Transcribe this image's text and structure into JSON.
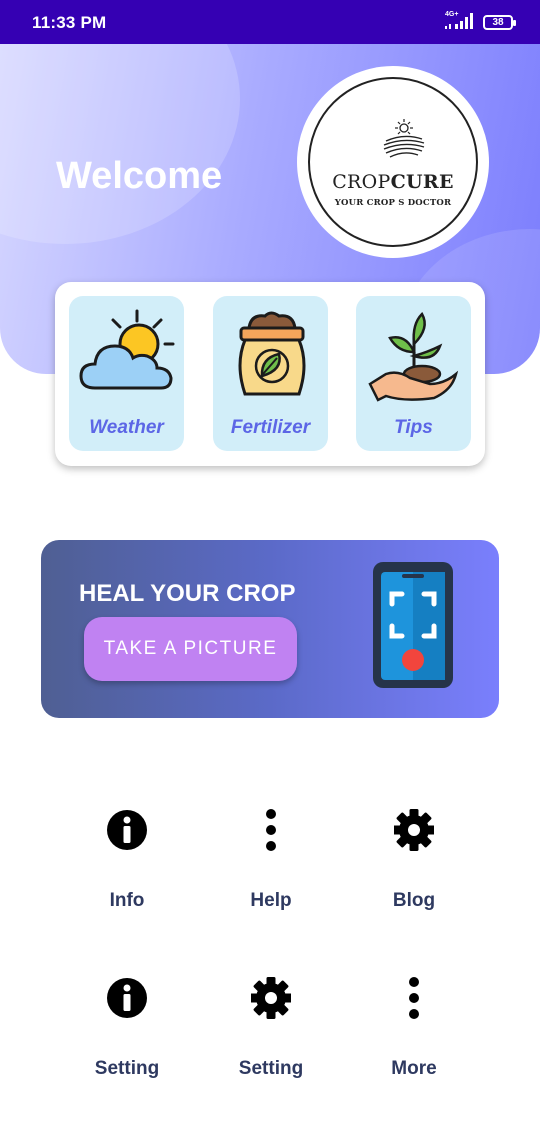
{
  "status_bar": {
    "time": "11:33 PM",
    "network": "4G+",
    "battery": "38"
  },
  "header": {
    "welcome": "Welcome"
  },
  "logo": {
    "brand_light": "CROP",
    "brand_bold": "CURE",
    "tagline": "YOUR CROP S DOCTOR"
  },
  "features": [
    {
      "label": "Weather",
      "icon": "weather-icon"
    },
    {
      "label": "Fertilizer",
      "icon": "fertilizer-icon"
    },
    {
      "label": "Tips",
      "icon": "plant-hand-icon"
    }
  ],
  "heal": {
    "title": "HEAL YOUR CROP",
    "button": "TAKE A PICTURE",
    "icon": "phone-scan-icon"
  },
  "menu": [
    {
      "label": "Info",
      "icon": "info-icon"
    },
    {
      "label": "Help",
      "icon": "more-vertical-icon"
    },
    {
      "label": "Blog",
      "icon": "gear-icon"
    },
    {
      "label": "Setting",
      "icon": "info-icon"
    },
    {
      "label": "Setting",
      "icon": "gear-icon"
    },
    {
      "label": "More",
      "icon": "more-vertical-icon"
    }
  ],
  "colors": {
    "status_bar": "#3500b3",
    "hero_start": "#d6d7ff",
    "hero_end": "#7b7dfd",
    "feature_card": "#d2eef9",
    "feature_label": "#5c66e6",
    "button": "#c082f2",
    "menu_label": "#2e3960"
  }
}
